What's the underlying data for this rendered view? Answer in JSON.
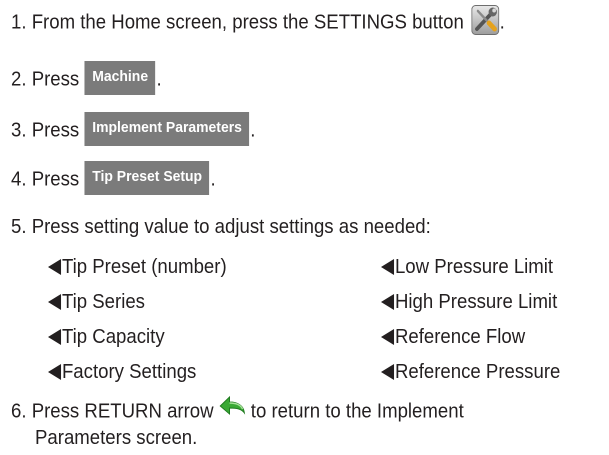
{
  "steps": [
    {
      "num": "1.",
      "text": "From the Home screen, press the SETTINGS button",
      "icon": "settings-wrench-screwdriver-icon",
      "after": "."
    },
    {
      "num": "2.",
      "text": "Press",
      "button": "Machine",
      "after": "."
    },
    {
      "num": "3.",
      "text": "Press",
      "button": "Implement Parameters",
      "after": "."
    },
    {
      "num": "4.",
      "text": "Press",
      "button": "Tip Preset Setup",
      "after": "."
    },
    {
      "num": "5.",
      "text": "Press setting value to adjust settings as needed:"
    },
    {
      "num": "6.",
      "text_before": "Press RETURN arrow",
      "icon": "return-arrow-icon",
      "text_after": "to return to the Implement",
      "line2": "Parameters screen."
    }
  ],
  "settings_left": [
    "Tip Preset (number)",
    "Tip Series",
    "Tip Capacity",
    "Factory Settings"
  ],
  "settings_right": [
    "Low Pressure Limit",
    "High Pressure Limit",
    "Reference Flow",
    "Reference Pressure"
  ],
  "colors": {
    "button_bg": "#7b7b7b",
    "button_text": "#ffffff",
    "text": "#231f20",
    "return_arrow": "#3aa935"
  }
}
